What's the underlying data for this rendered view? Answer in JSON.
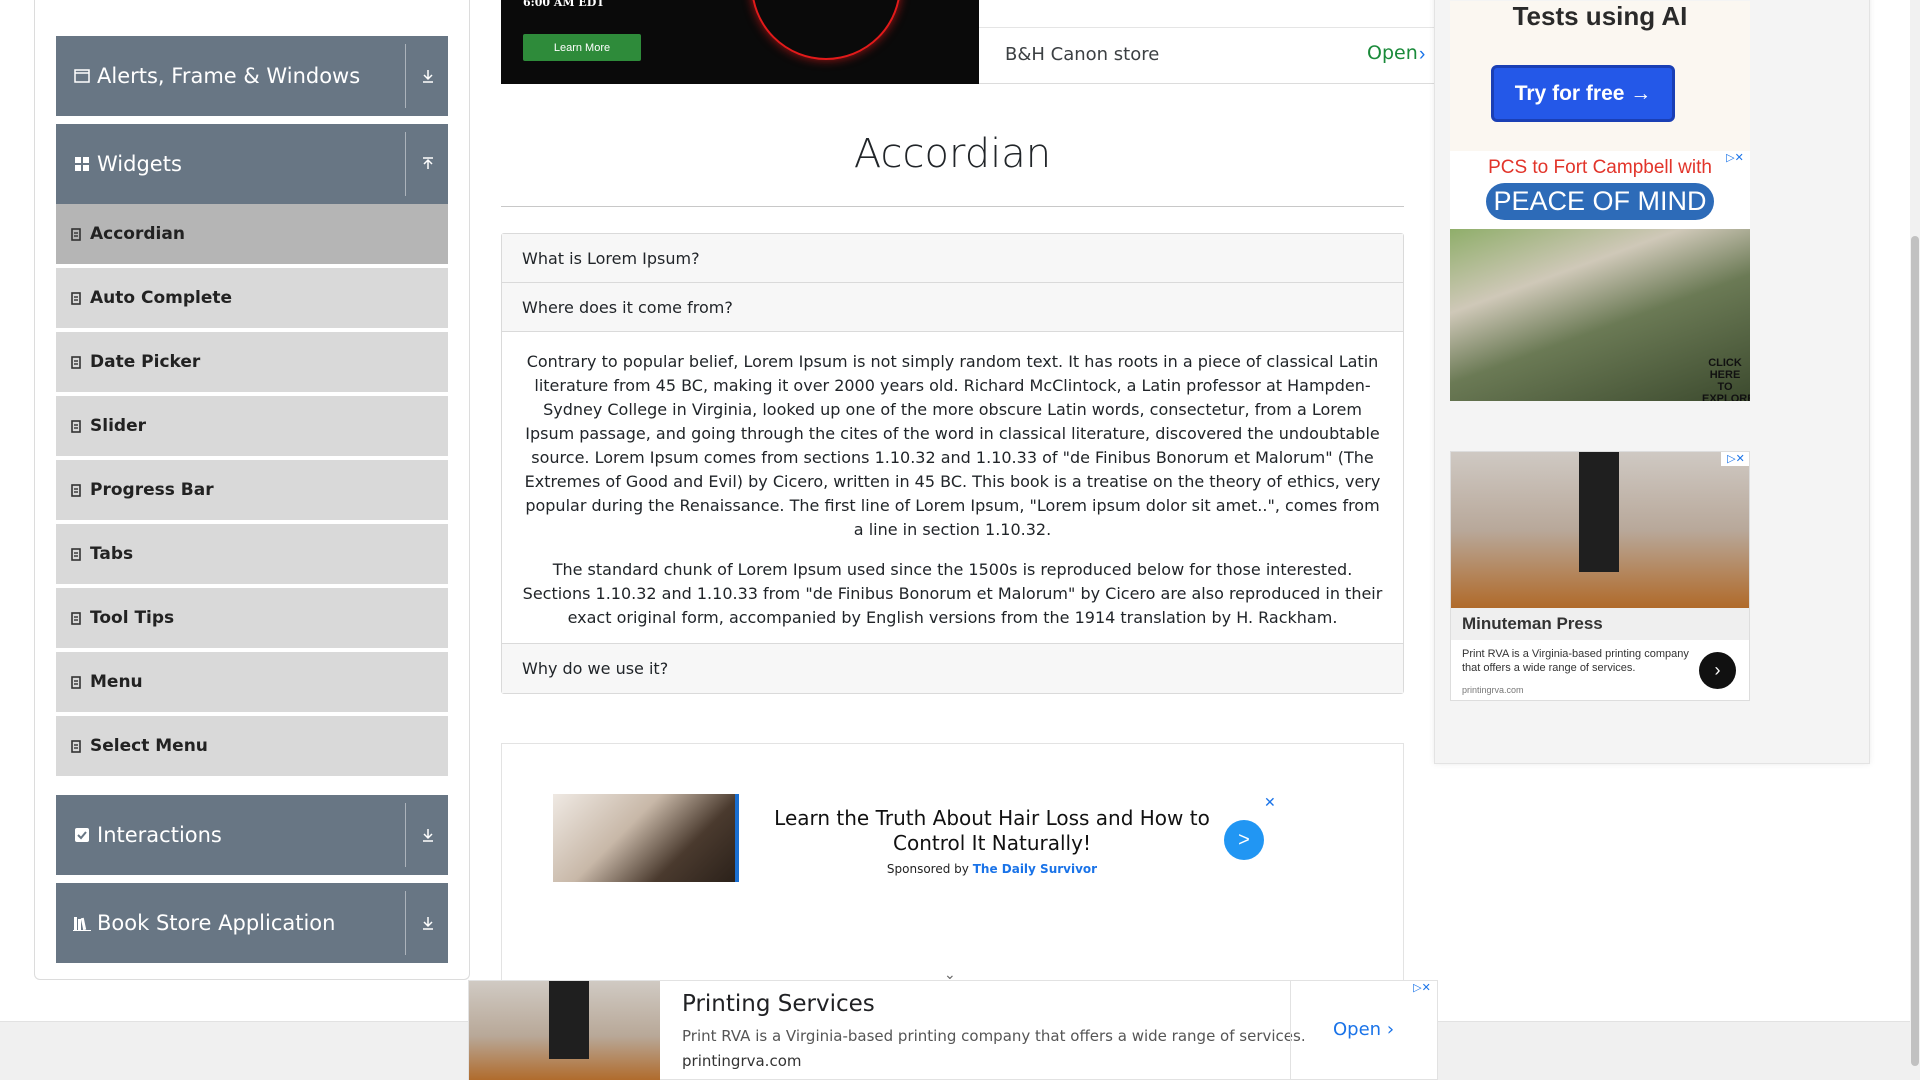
{
  "sidebar": {
    "groups": [
      {
        "label": "Alerts, Frame & Windows",
        "icon": "window-icon"
      },
      {
        "label": "Widgets",
        "icon": "widgets-grid-icon"
      },
      {
        "label": "Interactions",
        "icon": "interactions-icon"
      },
      {
        "label": "Book Store Application",
        "icon": "books-icon"
      }
    ],
    "items": [
      {
        "label": "Accordian",
        "active": true
      },
      {
        "label": "Auto Complete"
      },
      {
        "label": "Date Picker"
      },
      {
        "label": "Slider"
      },
      {
        "label": "Progress Bar"
      },
      {
        "label": "Tabs"
      },
      {
        "label": "Tool Tips"
      },
      {
        "label": "Menu"
      },
      {
        "label": "Select Menu"
      }
    ]
  },
  "top_ad": {
    "time_text": "6:00 AM EDT",
    "learn_more": "Learn More",
    "store_name": "B&H Canon store",
    "open_label": "Open"
  },
  "main": {
    "title": "Accordian",
    "sections": [
      {
        "header": "What is Lorem Ipsum?"
      },
      {
        "header": "Where does it come from?",
        "expanded": true,
        "paragraphs": [
          "Contrary to popular belief, Lorem Ipsum is not simply random text. It has roots in a piece of classical Latin literature from 45 BC, making it over 2000 years old. Richard McClintock, a Latin professor at Hampden-Sydney College in Virginia, looked up one of the more obscure Latin words, consectetur, from a Lorem Ipsum passage, and going through the cites of the word in classical literature, discovered the undoubtable source. Lorem Ipsum comes from sections 1.10.32 and 1.10.33 of \"de Finibus Bonorum et Malorum\" (The Extremes of Good and Evil) by Cicero, written in 45 BC. This book is a treatise on the theory of ethics, very popular during the Renaissance. The first line of Lorem Ipsum, \"Lorem ipsum dolor sit amet..\", comes from a line in section 1.10.32.",
          "The standard chunk of Lorem Ipsum used since the 1500s is reproduced below for those interested. Sections 1.10.32 and 1.10.33 from \"de Finibus Bonorum et Malorum\" by Cicero are also reproduced in their exact original form, accompanied by English versions from the 1914 translation by H. Rackham."
        ]
      },
      {
        "header": "Why do we use it?"
      }
    ]
  },
  "content_ad": {
    "headline": "Learn the Truth About Hair Loss and How to Control It Naturally!",
    "sponsored_prefix": "Sponsored by",
    "sponsor": "The Daily Survivor",
    "go_label": ">",
    "close_label": "✕"
  },
  "right_rail": {
    "top_text": "Tests using AI",
    "try_button": "Try for free →",
    "pcs_headline": "PCS to Fort Campbell with",
    "pcs_pill": "PEACE OF MIND",
    "pcs_click": "CLICK HERE TO EXPLORE",
    "mini_name": "Minuteman Press",
    "mini_desc": "Print RVA is a Virginia-based printing company that offers a wide range of services.",
    "mini_url": "printingrva.com"
  },
  "bottom_ad": {
    "title": "Printing Services",
    "desc": "Print RVA is a Virginia-based printing company that offers a wide range of services.",
    "url": "printingrva.com",
    "open_label": "Open"
  },
  "colors": {
    "sidebar_header": "#687684",
    "sidebar_item": "#d9d9d9",
    "sidebar_item_active": "#b5b5b5",
    "accent_blue": "#2458e8",
    "open_green": "#1a8a3a"
  }
}
